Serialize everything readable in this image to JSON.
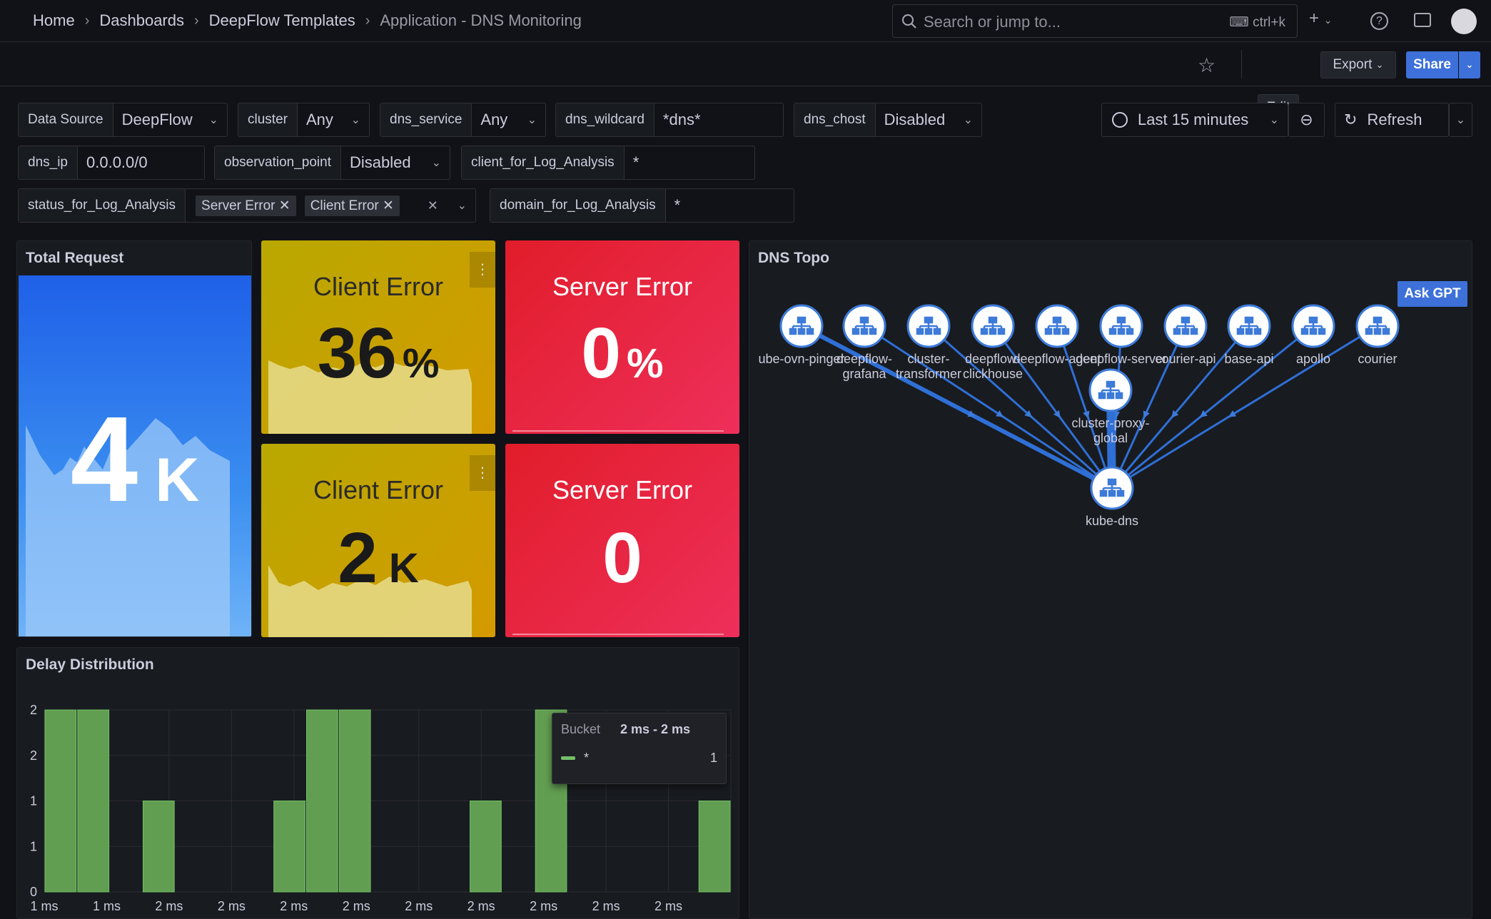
{
  "breadcrumb": [
    "Home",
    "Dashboards",
    "DeepFlow Templates",
    "Application - DNS Monitoring"
  ],
  "search": {
    "placeholder": "Search or jump to...",
    "shortcut": "ctrl+k"
  },
  "toolbar": {
    "edit": "Edit",
    "export": "Export",
    "share": "Share"
  },
  "variables": {
    "data_source": {
      "label": "Data Source",
      "value": "DeepFlow"
    },
    "cluster": {
      "label": "cluster",
      "value": "Any"
    },
    "dns_service": {
      "label": "dns_service",
      "value": "Any"
    },
    "dns_wildcard": {
      "label": "dns_wildcard",
      "value": "*dns*"
    },
    "dns_chost": {
      "label": "dns_chost",
      "value": "Disabled"
    },
    "dns_ip": {
      "label": "dns_ip",
      "value": "0.0.0.0/0"
    },
    "observation_point": {
      "label": "observation_point",
      "value": "Disabled"
    },
    "client_for_log": {
      "label": "client_for_Log_Analysis",
      "value": "*"
    },
    "status_for_log": {
      "label": "status_for_Log_Analysis",
      "chips": [
        "Server Error",
        "Client Error"
      ]
    },
    "domain_for_log": {
      "label": "domain_for_Log_Analysis",
      "value": "*"
    }
  },
  "time": {
    "range": "Last 15 minutes",
    "refresh": "Refresh"
  },
  "panels": {
    "total_request": {
      "title": "Total Request",
      "value": "4",
      "unit": "K"
    },
    "client_error_pct": {
      "title": "Client Error",
      "value": "36",
      "unit": "%"
    },
    "server_error_pct": {
      "title": "Server Error",
      "value": "0",
      "unit": "%"
    },
    "client_error_cnt": {
      "title": "Client Error",
      "value": "2",
      "unit": "K"
    },
    "server_error_cnt": {
      "title": "Server Error",
      "value": "0",
      "unit": ""
    },
    "dns_topo": {
      "title": "DNS Topo",
      "ask_gpt": "Ask GPT",
      "nodes": [
        {
          "label": "ube-ovn-pinger",
          "line2": ""
        },
        {
          "label": "deepflow-",
          "line2": "grafana"
        },
        {
          "label": "cluster-",
          "line2": "transformer"
        },
        {
          "label": "deepflow-",
          "line2": "clickhouse"
        },
        {
          "label": "deepflow-agent",
          "line2": ""
        },
        {
          "label": "deepflow-server",
          "line2": ""
        },
        {
          "label": "courier-api",
          "line2": ""
        },
        {
          "label": "base-api",
          "line2": ""
        },
        {
          "label": "apollo",
          "line2": ""
        },
        {
          "label": "courier",
          "line2": ""
        }
      ],
      "proxy": {
        "label": "cluster-proxy-",
        "line2": "global"
      },
      "target": {
        "label": "kube-dns"
      }
    },
    "delay": {
      "title": "Delay Distribution"
    }
  },
  "tooltip": {
    "bucket_label": "Bucket",
    "bucket_value": "2 ms - 2 ms",
    "series": "*",
    "count": "1"
  },
  "chart_data": {
    "type": "bar",
    "title": "Delay Distribution",
    "categories": [
      "1 ms",
      "1 ms",
      "2 ms",
      "2 ms",
      "2 ms",
      "2 ms",
      "2 ms",
      "2 ms",
      "2 ms",
      "2 ms",
      "2 ms"
    ],
    "values": [
      2,
      2,
      0,
      1,
      0,
      0,
      0,
      1,
      2,
      2,
      0,
      0,
      0,
      1,
      0,
      2,
      0,
      0,
      0,
      0,
      1
    ],
    "y_ticks": [
      "0",
      "1",
      "1",
      "2",
      "2"
    ],
    "ylim": [
      0,
      2
    ],
    "series": [
      {
        "name": "*",
        "color": "#629e51"
      }
    ]
  },
  "colors": {
    "client_error": "#d9a900",
    "server_error": "#e8203a",
    "total": "#2f7de8",
    "accent": "#3d71d9"
  }
}
